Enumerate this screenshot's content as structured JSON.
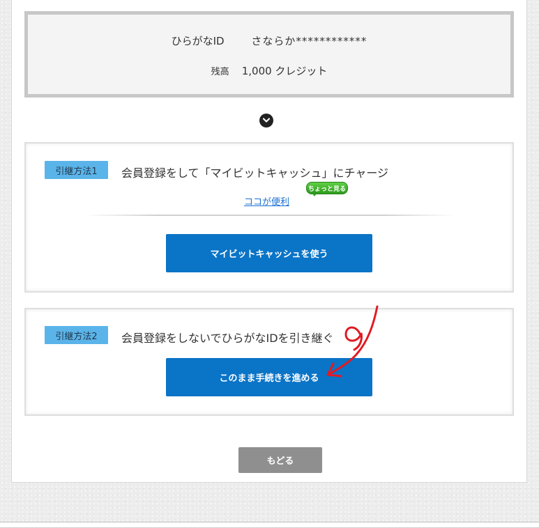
{
  "account": {
    "id_label": "ひらがなID",
    "id_value": "さならか************",
    "balance_label": "残高",
    "balance_value": "1,000 クレジット"
  },
  "method1": {
    "badge": "引継方法1",
    "title": "会員登録をして「マイビットキャッシュ」にチャージ",
    "link": "ココが便利",
    "bubble": "ちょっと見る",
    "button": "マイビットキャッシュを使う"
  },
  "method2": {
    "badge": "引継方法2",
    "title": "会員登録をしないでひらがなIDを引き継ぐ",
    "button": "このまま手続きを進める"
  },
  "back_button": "もどる",
  "colors": {
    "accent_blue": "#0a74c7",
    "badge_blue": "#5ab4ea",
    "bubble_green": "#2e9b1d",
    "annotation_red": "#e01b24"
  },
  "icons": {
    "expand": "chevron-down-icon"
  }
}
